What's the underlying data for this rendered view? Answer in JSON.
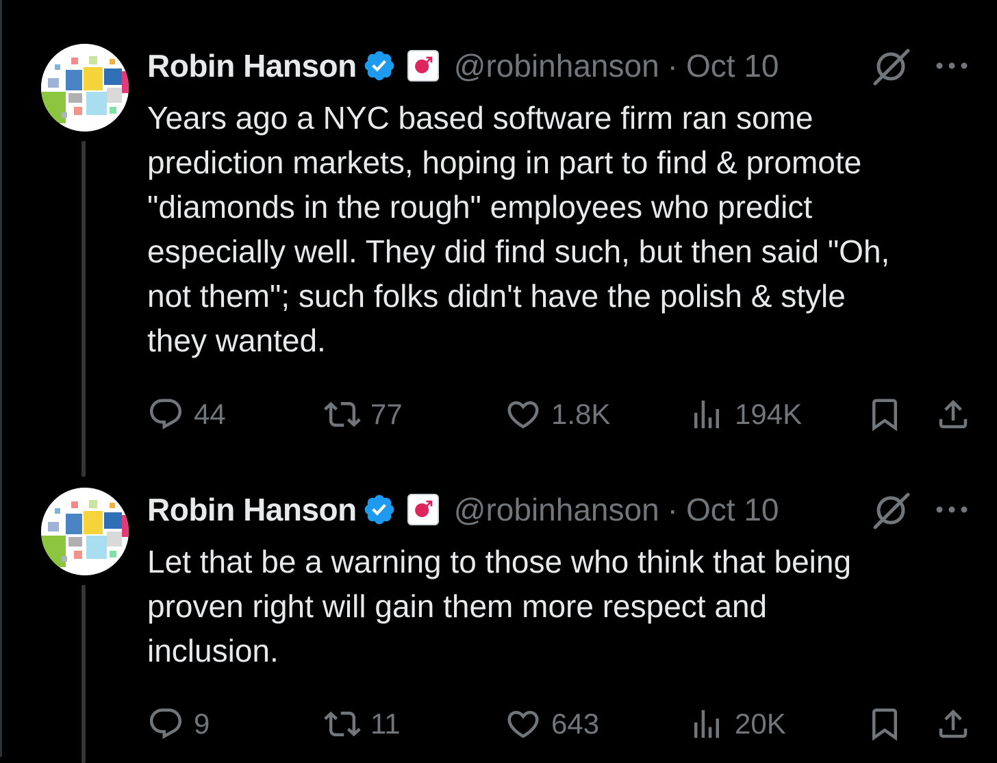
{
  "tweets": [
    {
      "author_name": "Robin Hanson",
      "handle": "@robinhanson",
      "separator": "·",
      "date": "Oct 10",
      "text_lines": [
        "Years ago a NYC based software firm ran some",
        "prediction markets, hoping in part to find & promote",
        "\"diamonds in the rough\" employees who predict",
        "especially well. They did find such, but then said \"Oh,",
        "not them\"; such folks didn't have the polish & style",
        "they wanted."
      ],
      "stats": {
        "replies": "44",
        "retweets": "77",
        "likes": "1.8K",
        "views": "194K"
      }
    },
    {
      "author_name": "Robin Hanson",
      "handle": "@robinhanson",
      "separator": "·",
      "date": "Oct 10",
      "text_lines": [
        "Let that be a warning to those who think that being",
        "proven right will gain them more respect and",
        "inclusion."
      ],
      "stats": {
        "replies": "9",
        "retweets": "11",
        "likes": "643",
        "views": "20K"
      }
    }
  ],
  "icons": {
    "verified": "verified-badge-icon",
    "affiliation": "affiliation-badge-icon",
    "grok": "grok-icon",
    "more": "more-icon",
    "reply": "reply-icon",
    "retweet": "retweet-icon",
    "like": "heart-icon",
    "views": "views-icon",
    "bookmark": "bookmark-icon",
    "share": "share-icon"
  },
  "colors": {
    "background": "#000000",
    "text_primary": "#e7e9ea",
    "text_secondary": "#71767b",
    "verified_blue": "#1d9bf0",
    "affiliation_red": "#e0245e"
  }
}
